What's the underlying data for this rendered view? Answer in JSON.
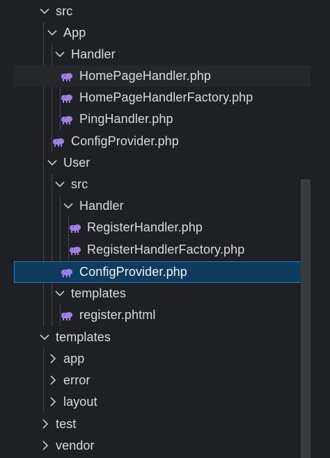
{
  "explorer": {
    "colors": {
      "background": "#1f2023",
      "selected_background": "#0d3c5f",
      "selected_border": "#2f79c0",
      "php_icon": "#9b7ee6",
      "text": "#d9dbdf"
    },
    "tree": [
      {
        "label": "src",
        "state": "expanded",
        "kind": "folder"
      },
      {
        "label": "App",
        "state": "expanded",
        "kind": "folder"
      },
      {
        "label": "Handler",
        "state": "expanded",
        "kind": "folder"
      },
      {
        "label": "HomePageHandler.php",
        "kind": "php-file"
      },
      {
        "label": "HomePageHandlerFactory.php",
        "kind": "php-file"
      },
      {
        "label": "PingHandler.php",
        "kind": "php-file"
      },
      {
        "label": "ConfigProvider.php",
        "kind": "php-file"
      },
      {
        "label": "User",
        "state": "expanded",
        "kind": "folder"
      },
      {
        "label": "src",
        "state": "expanded",
        "kind": "folder"
      },
      {
        "label": "Handler",
        "state": "expanded",
        "kind": "folder"
      },
      {
        "label": "RegisterHandler.php",
        "kind": "php-file"
      },
      {
        "label": "RegisterHandlerFactory.php",
        "kind": "php-file"
      },
      {
        "label": "ConfigProvider.php",
        "kind": "php-file",
        "selected": true
      },
      {
        "label": "templates",
        "state": "expanded",
        "kind": "folder"
      },
      {
        "label": "register.phtml",
        "kind": "php-file"
      },
      {
        "label": "templates",
        "state": "expanded",
        "kind": "folder"
      },
      {
        "label": "app",
        "state": "collapsed",
        "kind": "folder"
      },
      {
        "label": "error",
        "state": "collapsed",
        "kind": "folder"
      },
      {
        "label": "layout",
        "state": "collapsed",
        "kind": "folder"
      },
      {
        "label": "test",
        "state": "collapsed",
        "kind": "folder"
      },
      {
        "label": "vendor",
        "state": "collapsed",
        "kind": "folder"
      }
    ]
  }
}
